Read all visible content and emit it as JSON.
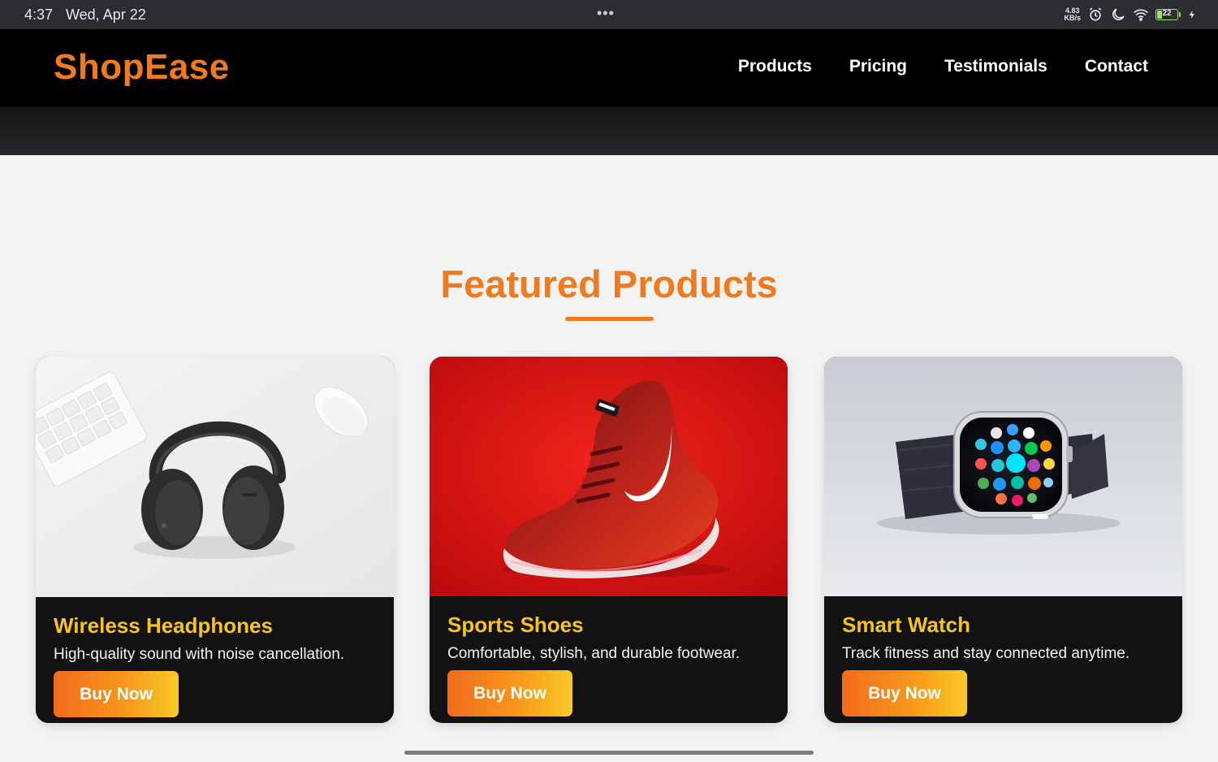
{
  "statusbar": {
    "time": "4:37",
    "date": "Wed, Apr 22",
    "dots": "•••",
    "net_speed_value": "4.83",
    "net_speed_unit": "KB/s",
    "battery_level": "22",
    "icons": [
      "alarm-icon",
      "moon-icon",
      "wifi-icon",
      "battery-icon",
      "charging-icon"
    ]
  },
  "nav": {
    "brand": "ShopEase",
    "links": [
      "Products",
      "Pricing",
      "Testimonials",
      "Contact"
    ]
  },
  "featured": {
    "title": "Featured Products",
    "products": [
      {
        "title": "Wireless Headphones",
        "description": "High-quality sound with noise cancellation.",
        "button": "Buy Now",
        "image": "headphones-image"
      },
      {
        "title": "Sports Shoes",
        "description": "Comfortable, stylish, and durable footwear.",
        "button": "Buy Now",
        "image": "shoe-image"
      },
      {
        "title": "Smart Watch",
        "description": "Track fitness and stay connected anytime.",
        "button": "Buy Now",
        "image": "watch-image"
      }
    ]
  },
  "colors": {
    "brand": "#f07a1e",
    "card_title": "#f7c31f",
    "card_bg": "#121212",
    "nav_bg": "#000000",
    "button_gradient": [
      "#f26b1d",
      "#f9c926"
    ]
  }
}
